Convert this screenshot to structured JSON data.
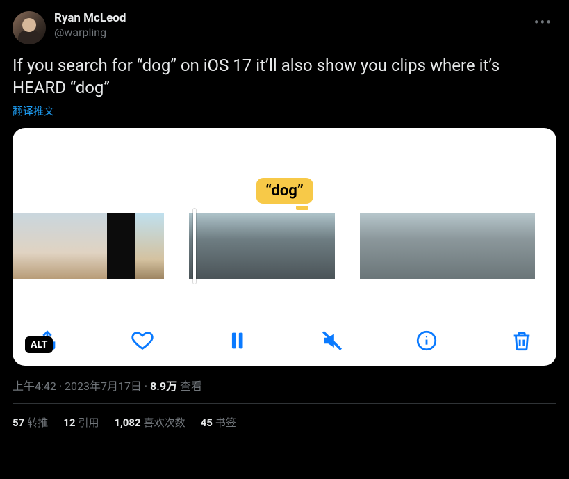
{
  "author": {
    "display_name": "Ryan McLeod",
    "handle": "@warpling"
  },
  "tweet_text": "If you search for “dog” on iOS 17 it’ll also show you clips where it’s HEARD “dog”",
  "translate_label": "翻译推文",
  "bubble_label": "“dog”",
  "alt_badge": "ALT",
  "meta": {
    "time": "上午4:42",
    "sep1": " · ",
    "date": "2023年7月17日",
    "sep2": " · ",
    "views_count": "8.9万",
    "views_label": " 查看"
  },
  "stats": {
    "retweets_count": "57",
    "retweets_label": "转推",
    "quotes_count": "12",
    "quotes_label": "引用",
    "likes_count": "1,082",
    "likes_label": "喜欢次数",
    "bookmarks_count": "45",
    "bookmarks_label": "书签"
  }
}
